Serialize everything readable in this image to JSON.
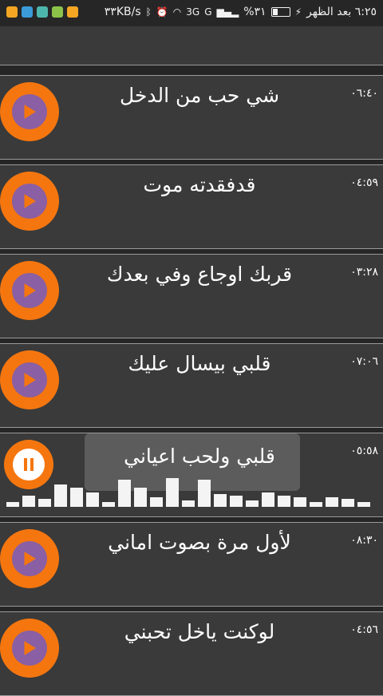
{
  "status_bar": {
    "time": "٦:٢٥ بعد الظهر",
    "battery": "٣١%",
    "network": "G",
    "network2": "3G",
    "speed": "٣٣KB/s",
    "app_icon_colors": [
      "#f5a623",
      "#3b9bd9",
      "#4db6ac",
      "#8bc34a",
      "#f5a623"
    ]
  },
  "colors": {
    "accent": "#f5760f",
    "play_inner": "#8a5fa3",
    "row_bg": "#3a3a3a"
  },
  "tracks": [
    {
      "title": "",
      "duration": ""
    },
    {
      "title": "شي حب من الدخل",
      "duration": "٠٦:٤٠"
    },
    {
      "title": "قدفقدته موت",
      "duration": "٠٤:٥٩"
    },
    {
      "title": "قربك اوجاع وفي بعدك",
      "duration": "٠٣:٢٨"
    },
    {
      "title": "قلبي بيسال عليك",
      "duration": "٠٧:٠٦"
    },
    {
      "title": "قلبي ولحب اعياني",
      "duration": "٠٥:٥٨",
      "playing": true
    },
    {
      "title": "لأول مرة بصوت اماني",
      "duration": "٠٨:٣٠"
    },
    {
      "title": "لوكنت ياخل تحبني",
      "duration": "٠٤:٥٦"
    }
  ],
  "equalizer_levels": [
    0.15,
    0.35,
    0.25,
    0.7,
    0.6,
    0.45,
    0.15,
    0.85,
    0.6,
    0.3,
    0.9,
    0.2,
    0.85,
    0.4,
    0.35,
    0.2,
    0.45,
    0.35,
    0.3,
    0.15,
    0.3,
    0.25,
    0.15
  ]
}
